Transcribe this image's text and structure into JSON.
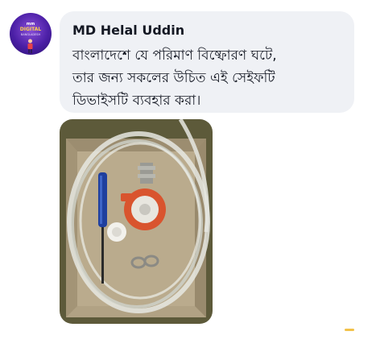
{
  "post": {
    "author": "MD Helal Uddin",
    "message_lines": [
      "বাংলাদেশে যে পরিমাণ বিষ্ফোরণ ঘটে,",
      "তার জন্য সকলের উচিত এই সেইফটি",
      "ডিভাইসটি ব্যবহার করা।"
    ]
  },
  "avatar": {
    "badge_top": "mm",
    "badge_logo": "DIGITAL",
    "badge_tag": "BANGLADESH"
  },
  "colors": {
    "bubble": "#eff1f5",
    "text": "#141823",
    "photo_bg": "#5d5a3a",
    "regulator": "#d9542e",
    "screwdriver": "#1f3f9e",
    "indicator": "#f2c24a"
  },
  "icons": {
    "photo": "attachment-photo",
    "indicator": "scroll-indicator"
  }
}
